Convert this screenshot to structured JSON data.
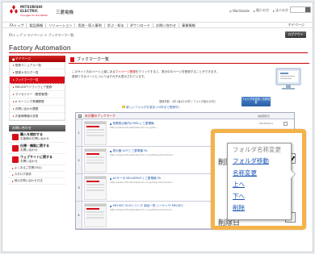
{
  "header": {
    "brand_line1": "MITSUBISHI",
    "brand_line2": "ELECTRIC",
    "tagline": "Changes for the Better",
    "corp_name": "三菱電機",
    "top_links": [
      "Worldwide",
      "個人の方",
      "法人の方"
    ],
    "brand_color": "#d80c18"
  },
  "nav": {
    "items": [
      "FAトップ",
      "製品情報",
      "ソリューション",
      "用途・導入事例",
      "学ぶ・知る",
      "ダウンロード",
      "お問い合わせ",
      "事業情報"
    ],
    "mypage": "マイページ"
  },
  "breadcrumb": "FAトップ > マイページ > ブックマーク一覧",
  "logout_label": "ログアウト",
  "site_title": "Factory Automation",
  "sidebar": {
    "head": "マイページ",
    "items": [
      {
        "label": "登録マニュアル一覧",
        "active": false
      },
      {
        "label": "登録カタログ一覧",
        "active": false
      },
      {
        "label": "ブックマーク一覧",
        "active": true
      },
      {
        "label": "MELSOFTソフトウェア登録",
        "active": false
      },
      {
        "label": "マイセミナー（履歴管理）",
        "active": false
      },
      {
        "label": "e-ラーニング受講履歴",
        "active": false
      },
      {
        "label": "お問い合わせ履歴",
        "active": false
      },
      {
        "label": "お客様情報の変更",
        "active": false
      }
    ],
    "contact_head": "お問い合わせ",
    "contacts": [
      {
        "title": "購入を検討する",
        "sub": "お客様のお問い合わせ"
      },
      {
        "title": "仕様・機能に関する",
        "sub": "お問い合わせ"
      },
      {
        "title": "ウェブサイトに関する",
        "sub": "お問い合わせ"
      }
    ],
    "small_links": [
      "よくあるご質問(FAQ)",
      "カタログ請求",
      "他のお問い合わせ方法"
    ]
  },
  "main": {
    "section_title": "ブックマーク一覧",
    "intro_line1_a": "このサイト内のページ上部にある",
    "intro_line1_hl": "マイページ登録",
    "intro_line1_b": "をクリックすると、表示中のページを登録することができます。",
    "intro_line2": "登録できるページについてはそれぞれ表示されています。",
    "toolbar_text": "登録件数：4件 (最大100件 / フォルダ最大10件)",
    "folder_btn": "フォルダを追加 / 名称変更",
    "create_folder_link": "新しいフォルダを追加 (10件まで登録可)",
    "list_header": "未分類のブックマーク",
    "list_header_right": "最終更新日",
    "rows": [
      {
        "num": "1",
        "title": "営業拠点案内(CIMS) | 三菱電機",
        "url": "http://www.mitsubishielectric.co.jp/fa/...",
        "date": "2013/04/11",
        "checked": false
      },
      {
        "num": "2",
        "title": "表示器 GOT | 三菱電機 FA",
        "url": "http://www.mitsubishielectric.co.jp/fa/products/hmi/...",
        "date": "2013/04/11",
        "checked": true
      },
      {
        "num": "3",
        "title": "ACサーボ MELSERVO | 三菱電機 FA",
        "url": "http://www.mitsubishielectric.co.jp/fa/products/drv/...",
        "date": "2013/04/11",
        "checked": false
      },
      {
        "num": "4",
        "title": "MELSEC iQ-Rシリーズ 製品一覧 シーケンサ MELSEC",
        "url": "http://www.mitsubishielectric.co.jp/fa/products/cnt/...",
        "date": "2013/04/11",
        "checked": false
      }
    ]
  },
  "zoom": {
    "label_top": "削除日",
    "label_bottom": "削除日",
    "menu_items": [
      {
        "label": "フォルダ名称変更",
        "enabled": false
      },
      {
        "label": "フォルダ移動",
        "enabled": true
      },
      {
        "label": "名称変更",
        "enabled": true
      },
      {
        "label": "上へ",
        "enabled": true
      },
      {
        "label": "下へ",
        "enabled": true
      },
      {
        "label": "削除",
        "enabled": true
      }
    ],
    "frame_color": "#f3b24a"
  }
}
